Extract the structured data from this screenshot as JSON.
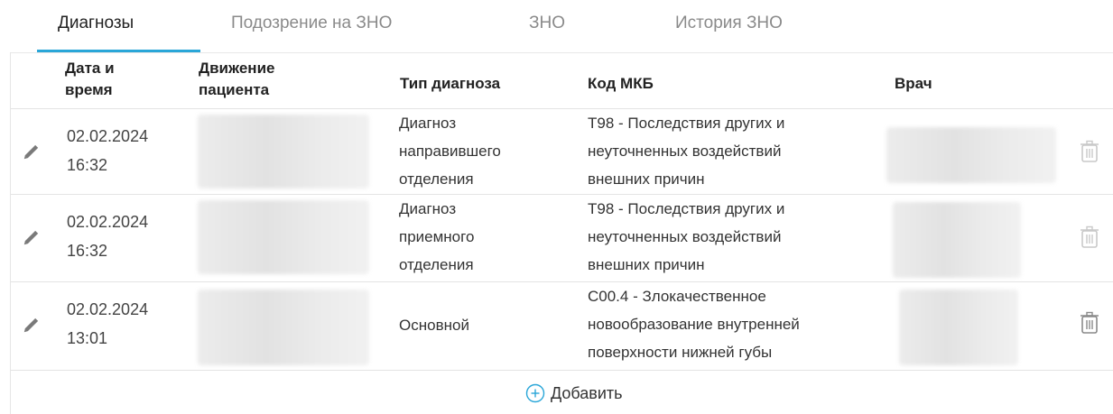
{
  "tabs": [
    {
      "label": "Диагнозы",
      "active": true
    },
    {
      "label": "Подозрение на ЗНО",
      "active": false
    },
    {
      "label": "ЗНО",
      "active": false
    },
    {
      "label": "История ЗНО",
      "active": false
    }
  ],
  "table": {
    "headers": {
      "datetime": [
        "Дата и",
        "время"
      ],
      "movement": [
        "Движение",
        "пациента"
      ],
      "diag_type": "Тип диагноза",
      "icd": "Код МКБ",
      "doctor": "Врач"
    },
    "rows": [
      {
        "date": "02.02.2024",
        "time": "16:32",
        "diag_type": [
          "Диагноз",
          "направившего",
          "отделения"
        ],
        "icd": [
          "T98 - Последствия других и",
          "неуточненных воздействий",
          "внешних причин"
        ]
      },
      {
        "date": "02.02.2024",
        "time": "16:32",
        "diag_type": [
          "Диагноз",
          "приемного",
          "отделения"
        ],
        "icd": [
          "T98 - Последствия других и",
          "неуточненных воздействий",
          "внешних причин"
        ]
      },
      {
        "date": "02.02.2024",
        "time": "13:01",
        "diag_type": [
          "Основной"
        ],
        "icd": [
          "C00.4 - Злокачественное",
          "новообразование внутренней",
          "поверхности нижней губы"
        ]
      }
    ],
    "add_label": "Добавить"
  },
  "icons": {
    "edit": "pencil-icon",
    "delete": "trash-icon",
    "add": "plus-circle-icon"
  },
  "colors": {
    "accent": "#29a6d8",
    "icon_muted": "#c9c9c9"
  }
}
